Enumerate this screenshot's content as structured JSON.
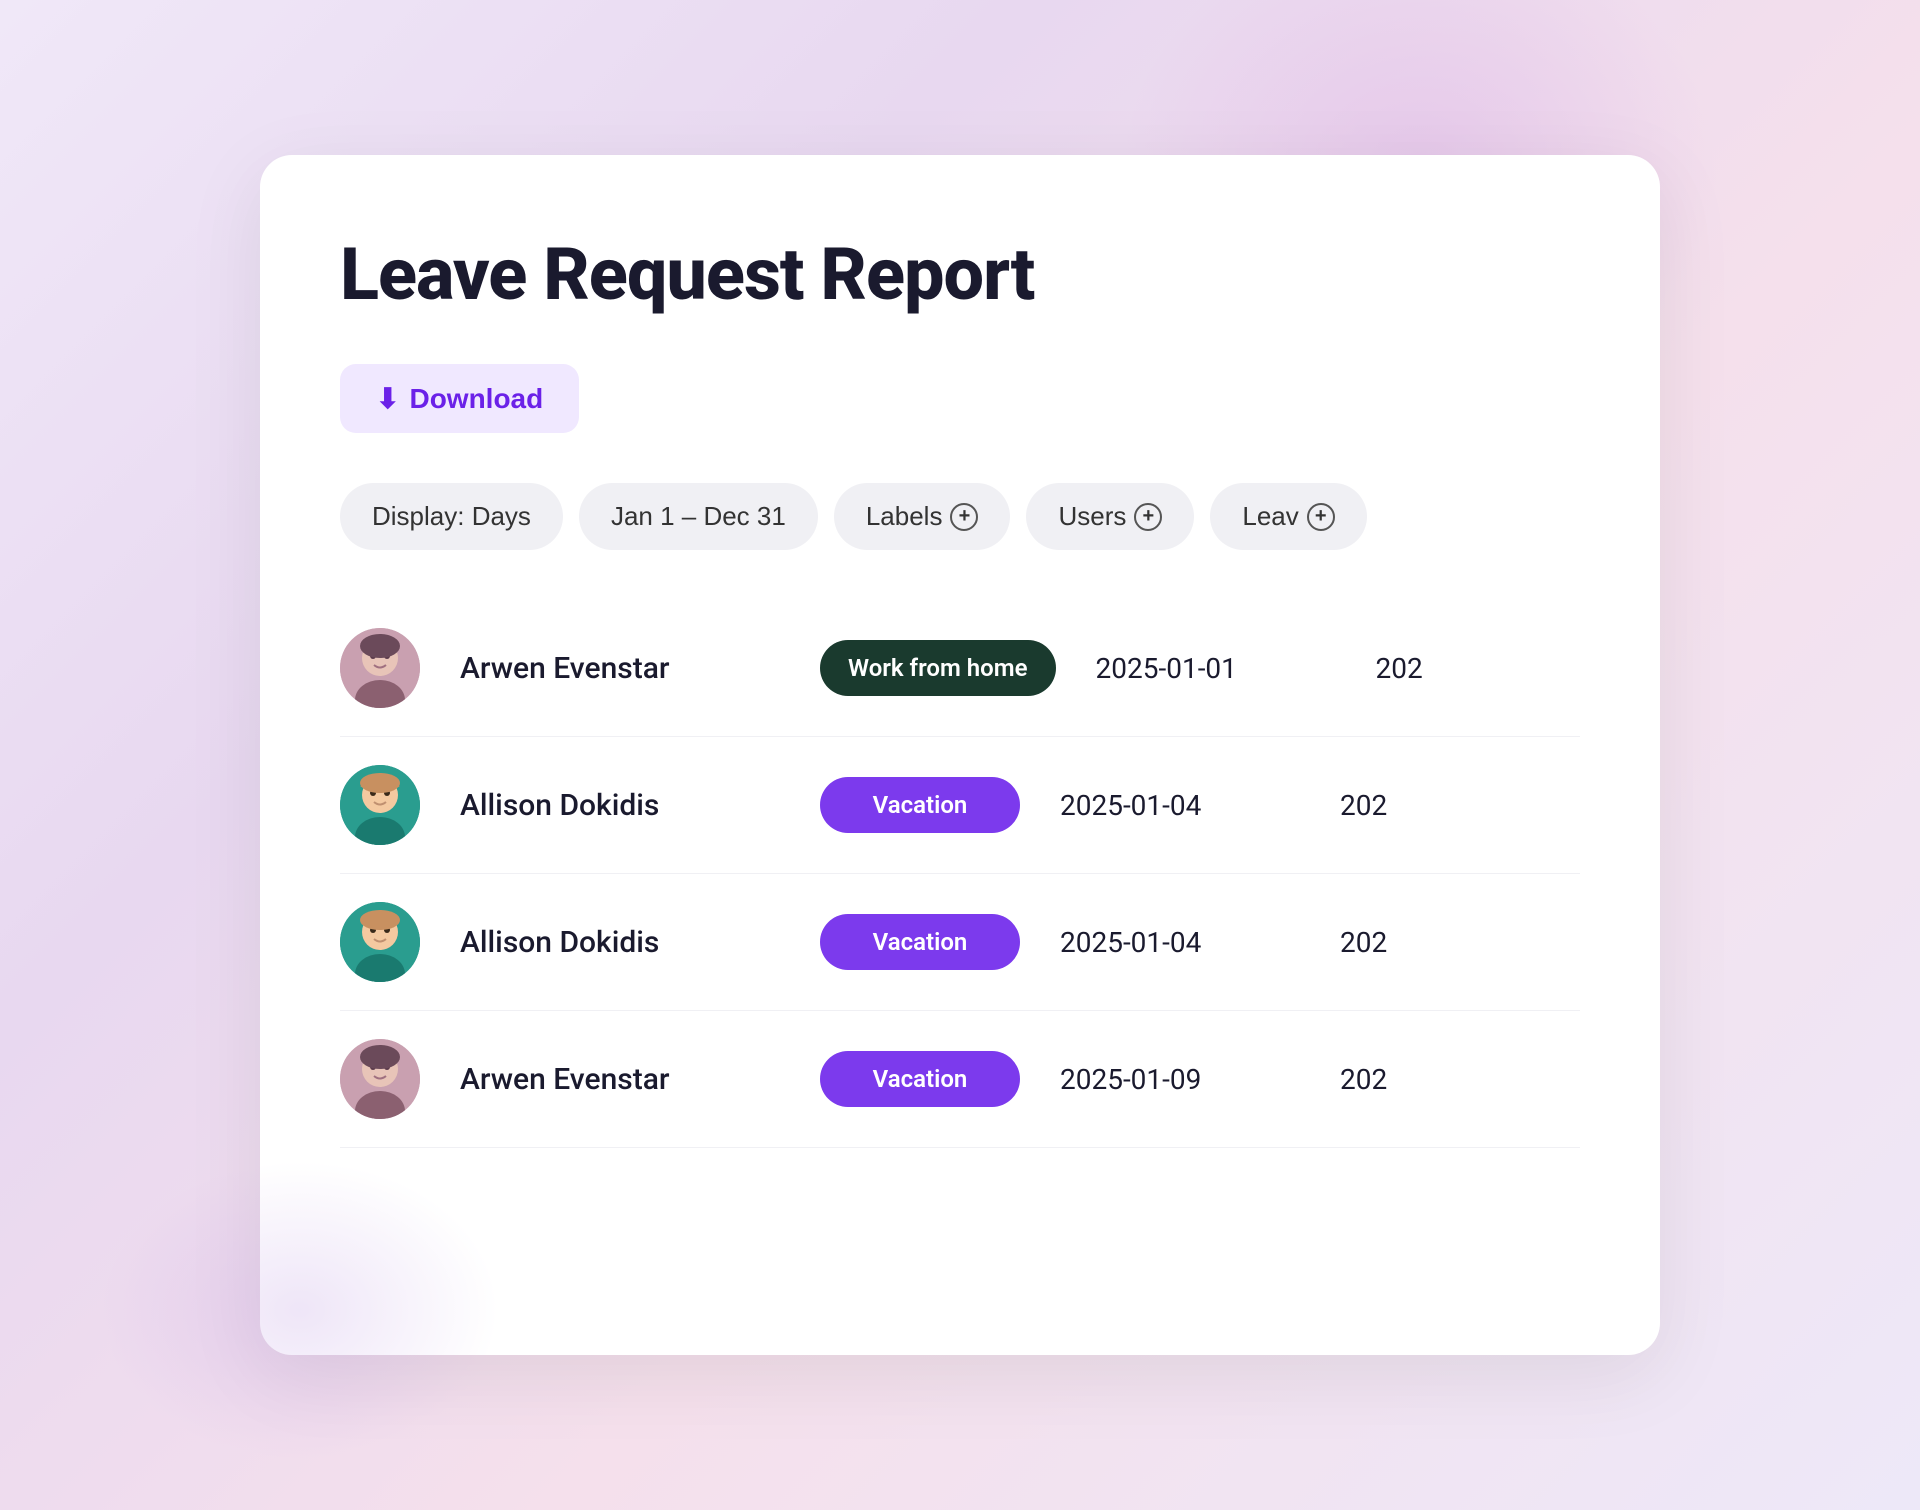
{
  "page": {
    "title": "Leave Request Report",
    "background_colors": [
      "#f0e8f8",
      "#e8d8f0",
      "#f5e0ec",
      "#ede8f8"
    ]
  },
  "toolbar": {
    "download_label": "Download"
  },
  "filters": [
    {
      "id": "display",
      "label": "Display: Days",
      "has_plus": false
    },
    {
      "id": "date_range",
      "label": "Jan 1 – Dec 31",
      "has_plus": false
    },
    {
      "id": "labels",
      "label": "Labels",
      "has_plus": true
    },
    {
      "id": "users",
      "label": "Users",
      "has_plus": true
    },
    {
      "id": "leave",
      "label": "Leav",
      "has_plus": true
    }
  ],
  "table": {
    "rows": [
      {
        "id": "row1",
        "person_name": "Arwen Evenstar",
        "avatar_type": "arwen",
        "leave_type": "Work from home",
        "badge_color": "wfh",
        "start_date": "2025-01-01",
        "end_date_partial": "202"
      },
      {
        "id": "row2",
        "person_name": "Allison Dokidis",
        "avatar_type": "allison1",
        "leave_type": "Vacation",
        "badge_color": "vacation",
        "start_date": "2025-01-04",
        "end_date_partial": "202"
      },
      {
        "id": "row3",
        "person_name": "Allison Dokidis",
        "avatar_type": "allison2",
        "leave_type": "Vacation",
        "badge_color": "vacation",
        "start_date": "2025-01-04",
        "end_date_partial": "202"
      },
      {
        "id": "row4",
        "person_name": "Arwen Evenstar",
        "avatar_type": "arwen2",
        "leave_type": "Vacation",
        "badge_color": "vacation",
        "start_date": "2025-01-09",
        "end_date_partial": "202"
      }
    ]
  }
}
